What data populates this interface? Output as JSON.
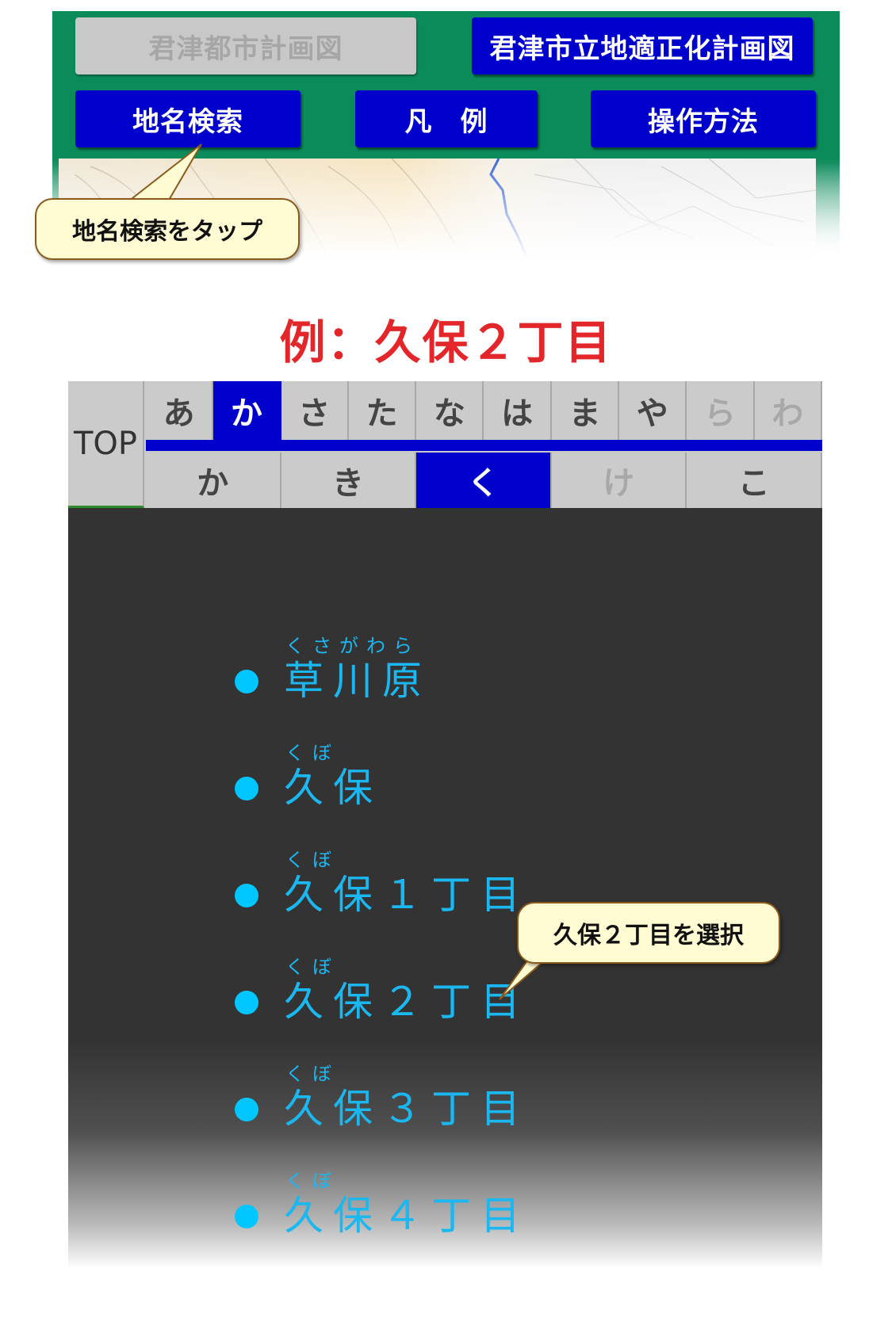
{
  "header": {
    "city_plan_button": "君津都市計画図",
    "location_plan_button": "君津市立地適正化計画図",
    "place_search_button": "地名検索",
    "legend_button": "凡　例",
    "howto_button": "操作方法"
  },
  "callouts": {
    "tap_search": "地名検索をタップ",
    "select_item": "久保２丁目を選択"
  },
  "example_title": "例：久保２丁目",
  "kana_index": {
    "top_label": "TOP",
    "rows": [
      "あ",
      "か",
      "さ",
      "た",
      "な",
      "は",
      "ま",
      "や",
      "ら",
      "わ"
    ],
    "active_row": "か",
    "disabled_rows": [
      "ら",
      "わ"
    ],
    "columns": [
      "か",
      "き",
      "く",
      "け",
      "こ"
    ],
    "active_column": "く",
    "disabled_columns": [
      "け"
    ]
  },
  "places": [
    {
      "ruby": "くさがわら",
      "name": "草川原"
    },
    {
      "ruby": "くぼ",
      "name": "久保"
    },
    {
      "ruby": "くぼ",
      "name": "久保１丁目"
    },
    {
      "ruby": "くぼ",
      "name": "久保２丁目"
    },
    {
      "ruby": "くぼ",
      "name": "久保３丁目"
    },
    {
      "ruby": "くぼ",
      "name": "久保４丁目"
    }
  ],
  "colors": {
    "header_green": "#0b8a5a",
    "button_blue": "#0000cc",
    "list_text": "#1bb7f0",
    "title_red": "#e3262a"
  }
}
